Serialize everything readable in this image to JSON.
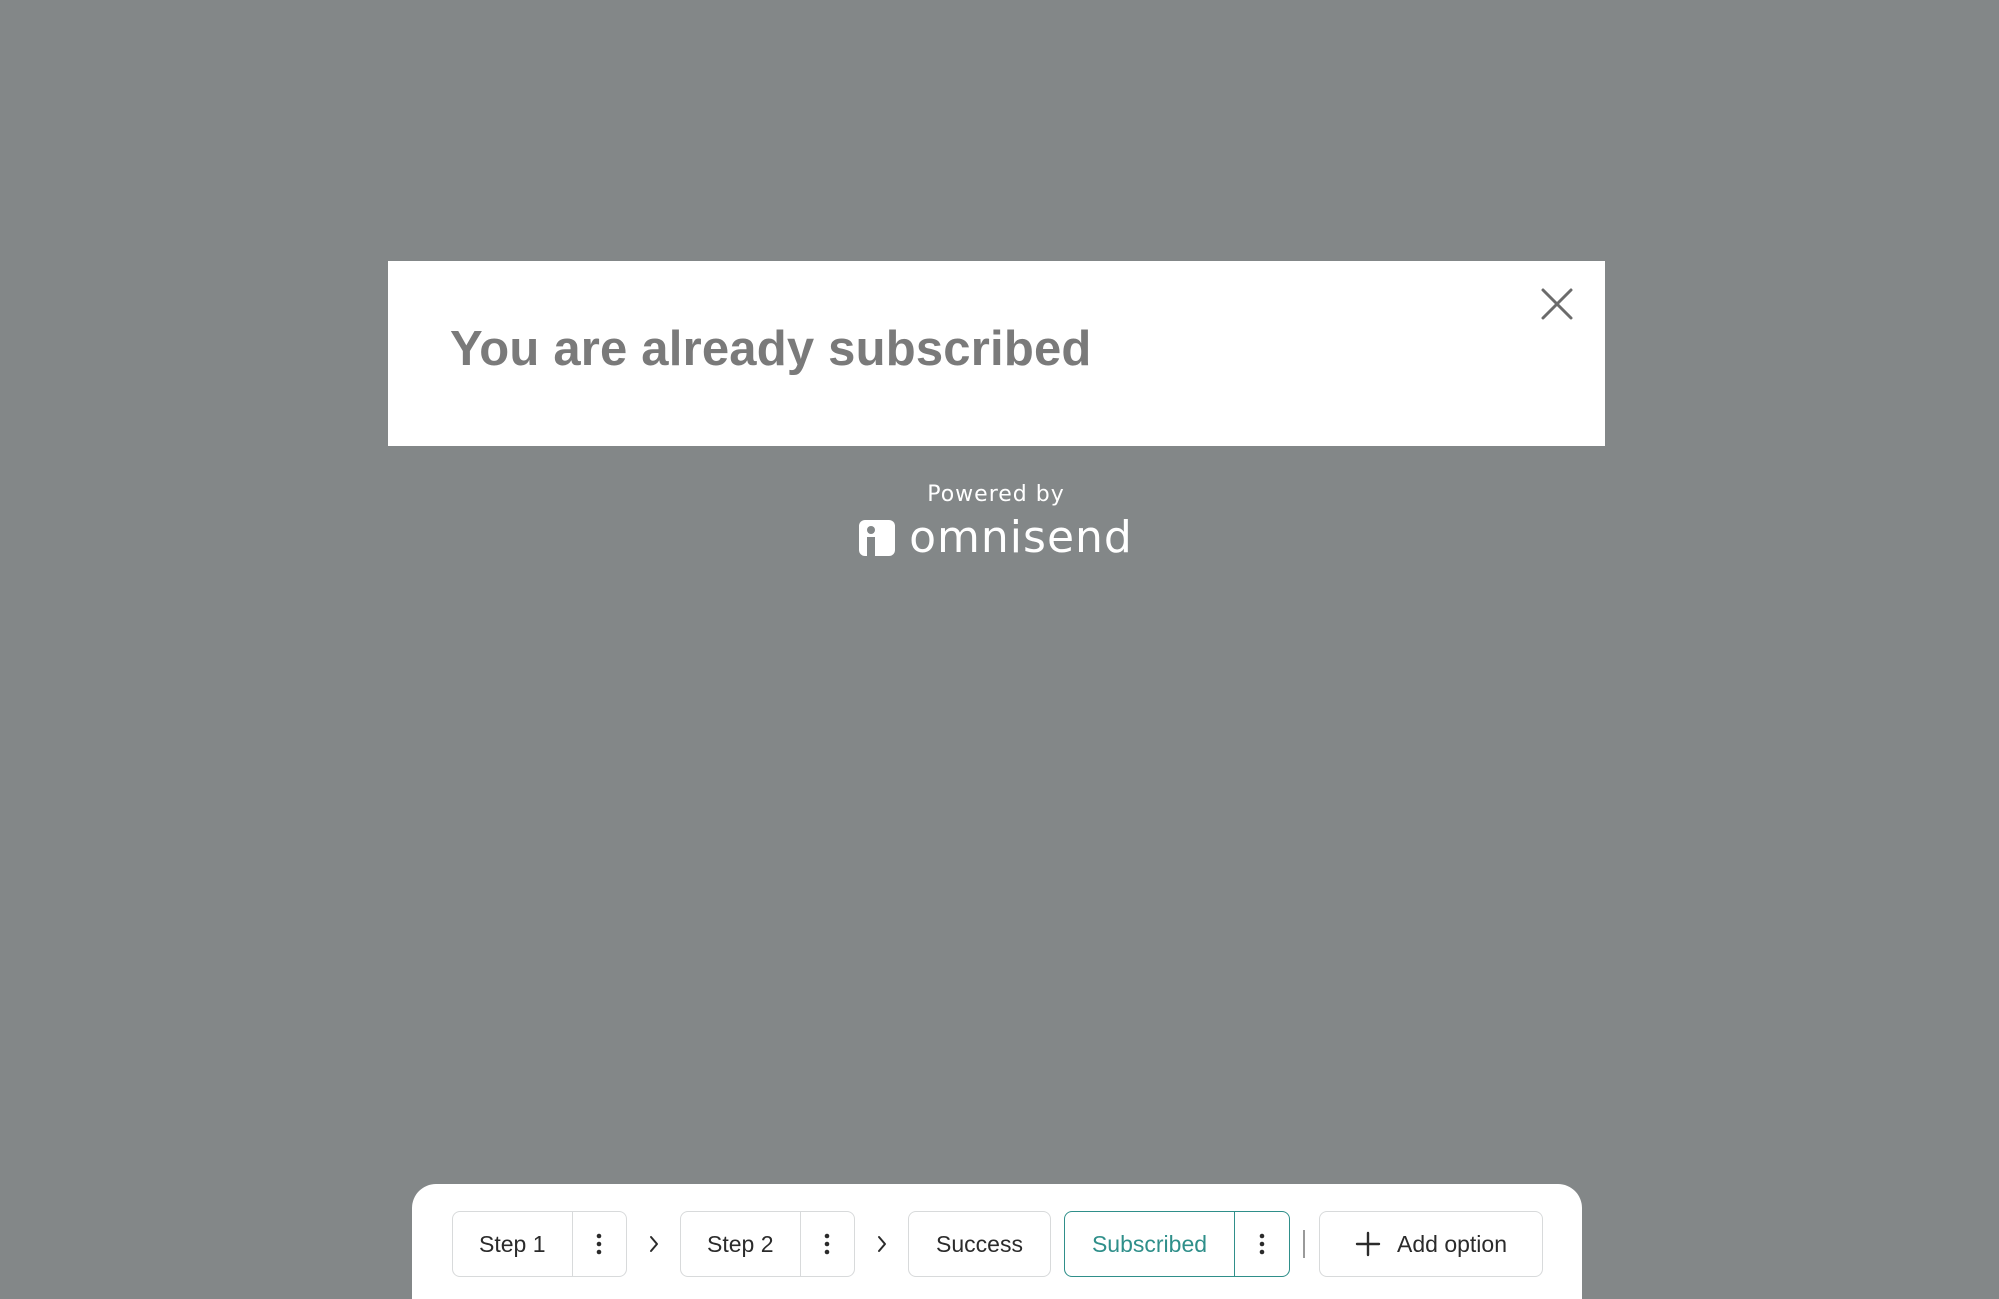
{
  "popup": {
    "title": "You are already subscribed"
  },
  "branding": {
    "powered_by": "Powered by",
    "brand_name": "omnisend"
  },
  "toolbar": {
    "steps": [
      {
        "label": "Step 1",
        "has_menu": true,
        "active": false
      },
      {
        "label": "Step 2",
        "has_menu": true,
        "active": false
      },
      {
        "label": "Success",
        "has_menu": false,
        "active": false
      },
      {
        "label": "Subscribed",
        "has_menu": true,
        "active": true
      }
    ],
    "add_option_label": "Add option"
  },
  "colors": {
    "backdrop": "#838788",
    "popup_background": "#ffffff",
    "title_text": "#7a7a7a",
    "accent": "#2f8f8a",
    "chip_border": "#d8dadb"
  },
  "icons": {
    "close": "close-icon",
    "menu": "vertical-dots-icon",
    "arrow": "chevron-right-icon",
    "add": "plus-icon",
    "logo": "omnisend-logo-icon"
  }
}
